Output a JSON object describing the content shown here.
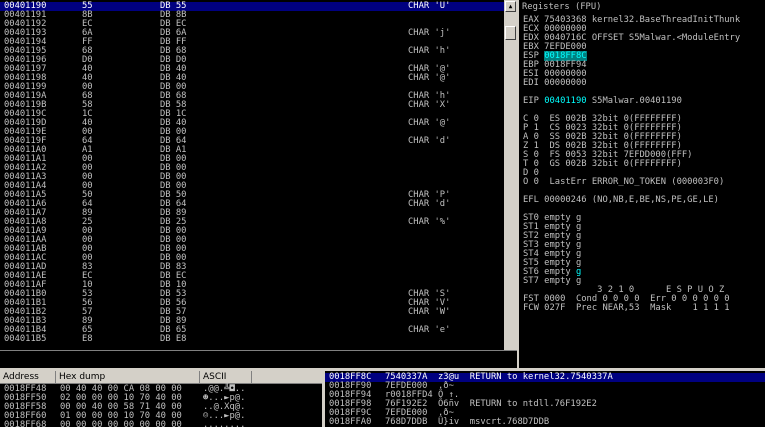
{
  "disasm": {
    "rows": [
      {
        "addr": "00401190",
        "hex": "55",
        "dis": "DB 55",
        "com": "CHAR 'U'"
      },
      {
        "addr": "00401191",
        "hex": "8B",
        "dis": "DB 8B",
        "com": ""
      },
      {
        "addr": "00401192",
        "hex": "EC",
        "dis": "DB EC",
        "com": ""
      },
      {
        "addr": "00401193",
        "hex": "6A",
        "dis": "DB 6A",
        "com": "CHAR 'j'"
      },
      {
        "addr": "00401194",
        "hex": "FF",
        "dis": "DB FF",
        "com": ""
      },
      {
        "addr": "00401195",
        "hex": "68",
        "dis": "DB 68",
        "com": "CHAR 'h'"
      },
      {
        "addr": "00401196",
        "hex": "D0",
        "dis": "DB D0",
        "com": ""
      },
      {
        "addr": "00401197",
        "hex": "40",
        "dis": "DB 40",
        "com": "CHAR '@'"
      },
      {
        "addr": "00401198",
        "hex": "40",
        "dis": "DB 40",
        "com": "CHAR '@'"
      },
      {
        "addr": "00401199",
        "hex": "00",
        "dis": "DB 00",
        "com": ""
      },
      {
        "addr": "0040119A",
        "hex": "68",
        "dis": "DB 68",
        "com": "CHAR 'h'"
      },
      {
        "addr": "0040119B",
        "hex": "58",
        "dis": "DB 58",
        "com": "CHAR 'X'"
      },
      {
        "addr": "0040119C",
        "hex": "1C",
        "dis": "DB 1C",
        "com": ""
      },
      {
        "addr": "0040119D",
        "hex": "40",
        "dis": "DB 40",
        "com": "CHAR '@'"
      },
      {
        "addr": "0040119E",
        "hex": "00",
        "dis": "DB 00",
        "com": ""
      },
      {
        "addr": "0040119F",
        "hex": "64",
        "dis": "DB 64",
        "com": "CHAR 'd'"
      },
      {
        "addr": "004011A0",
        "hex": "A1",
        "dis": "DB A1",
        "com": ""
      },
      {
        "addr": "004011A1",
        "hex": "00",
        "dis": "DB 00",
        "com": ""
      },
      {
        "addr": "004011A2",
        "hex": "00",
        "dis": "DB 00",
        "com": ""
      },
      {
        "addr": "004011A3",
        "hex": "00",
        "dis": "DB 00",
        "com": ""
      },
      {
        "addr": "004011A4",
        "hex": "00",
        "dis": "DB 00",
        "com": ""
      },
      {
        "addr": "004011A5",
        "hex": "50",
        "dis": "DB 50",
        "com": "CHAR 'P'"
      },
      {
        "addr": "004011A6",
        "hex": "64",
        "dis": "DB 64",
        "com": "CHAR 'd'"
      },
      {
        "addr": "004011A7",
        "hex": "89",
        "dis": "DB 89",
        "com": ""
      },
      {
        "addr": "004011A8",
        "hex": "25",
        "dis": "DB 25",
        "com": "CHAR '%'"
      },
      {
        "addr": "004011A9",
        "hex": "00",
        "dis": "DB 00",
        "com": ""
      },
      {
        "addr": "004011AA",
        "hex": "00",
        "dis": "DB 00",
        "com": ""
      },
      {
        "addr": "004011AB",
        "hex": "00",
        "dis": "DB 00",
        "com": ""
      },
      {
        "addr": "004011AC",
        "hex": "00",
        "dis": "DB 00",
        "com": ""
      },
      {
        "addr": "004011AD",
        "hex": "83",
        "dis": "DB 83",
        "com": ""
      },
      {
        "addr": "004011AE",
        "hex": "EC",
        "dis": "DB EC",
        "com": ""
      },
      {
        "addr": "004011AF",
        "hex": "10",
        "dis": "DB 10",
        "com": ""
      },
      {
        "addr": "004011B0",
        "hex": "53",
        "dis": "DB 53",
        "com": "CHAR 'S'"
      },
      {
        "addr": "004011B1",
        "hex": "56",
        "dis": "DB 56",
        "com": "CHAR 'V'"
      },
      {
        "addr": "004011B2",
        "hex": "57",
        "dis": "DB 57",
        "com": "CHAR 'W'"
      },
      {
        "addr": "004011B3",
        "hex": "89",
        "dis": "DB 89",
        "com": ""
      },
      {
        "addr": "004011B4",
        "hex": "65",
        "dis": "DB 65",
        "com": "CHAR 'e'"
      },
      {
        "addr": "004011B5",
        "hex": "E8",
        "dis": "DB E8",
        "com": ""
      }
    ]
  },
  "registers": {
    "title": "Registers (FPU)",
    "lines": [
      "EAX 75403368 kernel32.BaseThreadInitThunk",
      "ECX 00000000",
      "EDX 0040716C OFFSET S5Malwar.<ModuleEntry",
      "EBX 7EFDE000",
      "ESP 0018FF8C",
      "EBP 0018FF94",
      "ESI 00000000",
      "EDI 00000000",
      "",
      "EIP 00401190 S5Malwar.00401190",
      "",
      "C 0  ES 002B 32bit 0(FFFFFFFF)",
      "P 1  CS 0023 32bit 0(FFFFFFFF)",
      "A 0  SS 002B 32bit 0(FFFFFFFF)",
      "Z 1  DS 002B 32bit 0(FFFFFFFF)",
      "S 0  FS 0053 32bit 7EFDD000(FFF)",
      "T 0  GS 002B 32bit 0(FFFFFFFF)",
      "D 0",
      "O 0  LastErr ERROR_NO_TOKEN (000003F0)",
      "",
      "EFL 00000246 (NO,NB,E,BE,NS,PE,GE,LE)",
      "",
      "ST0 empty g",
      "ST1 empty g",
      "ST2 empty g",
      "ST3 empty g",
      "ST4 empty g",
      "ST5 empty g",
      "ST6 empty g",
      "ST7 empty g",
      "              3 2 1 0      E S P U O Z",
      "FST 0000  Cond 0 0 0 0  Err 0 0 0 0 0 0",
      "FCW 027F  Prec NEAR,53  Mask    1 1 1 1"
    ],
    "esp_value": "0018FF8C",
    "eip_value": "00401190"
  },
  "dump": {
    "headers": [
      "Address",
      "Hex dump",
      "ASCII"
    ],
    "rows": [
      {
        "addr": "0018FF48",
        "hex": "00 40 40 00 CA 08 00 00",
        "ascii": ".@@.╩◘.."
      },
      {
        "addr": "0018FF50",
        "hex": "02 00 00 00 10 70 40 00",
        "ascii": "☻...►p@."
      },
      {
        "addr": "0018FF58",
        "hex": "00 00 40 00 58 71 40 00",
        "ascii": "..@.Xq@."
      },
      {
        "addr": "0018FF60",
        "hex": "01 00 00 00 10 70 40 00",
        "ascii": "☺...►p@."
      },
      {
        "addr": "0018FF68",
        "hex": "00 00 00 00 00 00 00 00",
        "ascii": "........"
      }
    ]
  },
  "stack": {
    "rows": [
      {
        "addr": "0018FF8C",
        "val": "7540337A",
        "com": "z3@u  RETURN to kernel32.7540337A"
      },
      {
        "addr": "0018FF90",
        "val": "7EFDE000",
        "com": ".ð~"
      },
      {
        "addr": "0018FF94",
        "val": "r0018FFD4",
        "com": "Ô ↑."
      },
      {
        "addr": "0018FF98",
        "val": "76F192E2",
        "com": "Ô6ñv  RETURN to ntdll.76F192E2"
      },
      {
        "addr": "0018FF9C",
        "val": "7EFDE000",
        "com": ".ð~"
      },
      {
        "addr": "0018FFA0",
        "val": "768D7DDB",
        "com": "Û}iv  msvcrt.768D7DDB"
      }
    ]
  }
}
